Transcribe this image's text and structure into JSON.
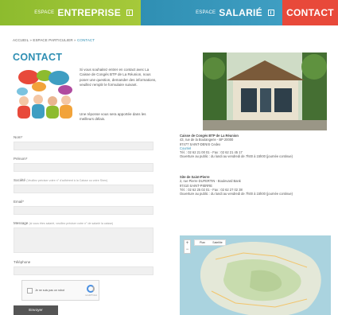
{
  "nav": {
    "entreprise_small": "ESPACE",
    "entreprise_big": "ENTREPRISE",
    "salarie_small": "ESPACE",
    "salarie_big": "SALARIÉ",
    "contact": "CONTACT",
    "colors": {
      "green": "#8dbb2e",
      "blue": "#2f8fb3",
      "red": "#e8493a"
    }
  },
  "breadcrumb": {
    "home": "ACCUEIL",
    "mid": "ESPACE PARTICULIER",
    "current": "CONTACT",
    "sep": " » "
  },
  "page_title": "CONTACT",
  "intro": {
    "text": "Si vous souhaitez entrer en contact avec La Caisse de Congés BTP de La Réunion, nous poser une question, demander des informations, veuillez remplir le formulaire suivant.",
    "note": "Une réponse vous sera apportée dans les meilleurs délais."
  },
  "form": {
    "nom": "Nom*",
    "prenom": "Prénom*",
    "societe": "Société",
    "societe_hint": "(Veuillez préciser votre n° d'adhérent à la Caisse ou votre Siren)",
    "email": "Email*",
    "message": "Message",
    "message_hint": "(si vous êtes salarié, veuillez préciser votre n° de salarié la caisse)",
    "telephone": "Téléphone",
    "captcha_label": "Je ne suis pas un robot",
    "captcha_sub": "reCAPTCHA",
    "submit": "Envoyer"
  },
  "address": {
    "org": "Caisse de Congés BTP de La Réunion",
    "line1": "43, rue de la Boulangerie - BP 20000",
    "line2": "97477 SAINT-DENIS Cedex",
    "email": "Courriel",
    "tel": "Tél. : 02 62 21 00 01 - Fax : 02 62 21 45 17",
    "hours": "Ouverture au public : du lundi au vendredi de 7h00 à 15h00 (journée continue)",
    "site2": "Site de Saint-Pierre",
    "site2_line1": "2, rue Pierre DUFERTIN - Boulevard Bank",
    "site2_line2": "97410 SAINT-PIERRE",
    "site2_tel": "Tél. : 02 62 25 02 01 - Fax : 02 62 27 02 38",
    "site2_hours": "Ouverture au public : du lundi au vendredi de 7h00 à 15h00 (journée continue)"
  },
  "map": {
    "plan": "Plan",
    "satellite": "Satellite",
    "zoom_in": "+",
    "zoom_out": "−"
  }
}
